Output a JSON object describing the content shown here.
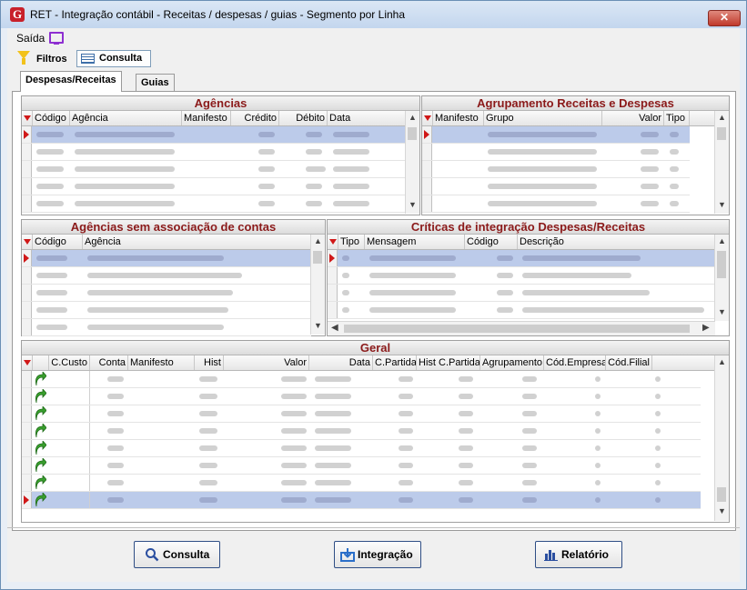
{
  "window": {
    "title": "RET - Integração contábil - Receitas / despesas / guias - Segmento por Linha",
    "app_icon_letter": "G",
    "close_label": "✕"
  },
  "menu": {
    "saida_label": "Saída"
  },
  "toolbar": {
    "filtros_label": "Filtros",
    "consulta_label": "Consulta"
  },
  "tabs": {
    "despesas_receitas": "Despesas/Receitas",
    "guias": "Guias"
  },
  "agencias": {
    "title": "Agências",
    "columns": [
      "Código",
      "Agência",
      "Manifesto",
      "Crédito",
      "Débito",
      "Data"
    ]
  },
  "agrupamento": {
    "title": "Agrupamento Receitas e Despesas",
    "columns": [
      "Manifesto",
      "Grupo",
      "Valor",
      "Tipo"
    ]
  },
  "agencias_sem": {
    "title": "Agências sem associação de contas",
    "columns": [
      "Código",
      "Agência"
    ]
  },
  "criticas": {
    "title": "Críticas de integração Despesas/Receitas",
    "columns": [
      "Tipo",
      "Mensagem",
      "Código",
      "Descrição"
    ]
  },
  "geral": {
    "title": "Geral",
    "columns": [
      "C.Custo",
      "Conta",
      "Manifesto",
      "Hist",
      "Valor",
      "Data",
      "C.Partida",
      "Hist C.Partida",
      "Agrupamento",
      "Cód.Empresa",
      "Cód.Filial"
    ]
  },
  "buttons": {
    "consulta": "Consulta",
    "integracao": "Integração",
    "relatorio": "Relatório"
  },
  "colors": {
    "pane_title": "#8b1a1a",
    "selected_row": "#bccbea",
    "indicator": "#d01818",
    "button_border": "#2f4e85"
  }
}
